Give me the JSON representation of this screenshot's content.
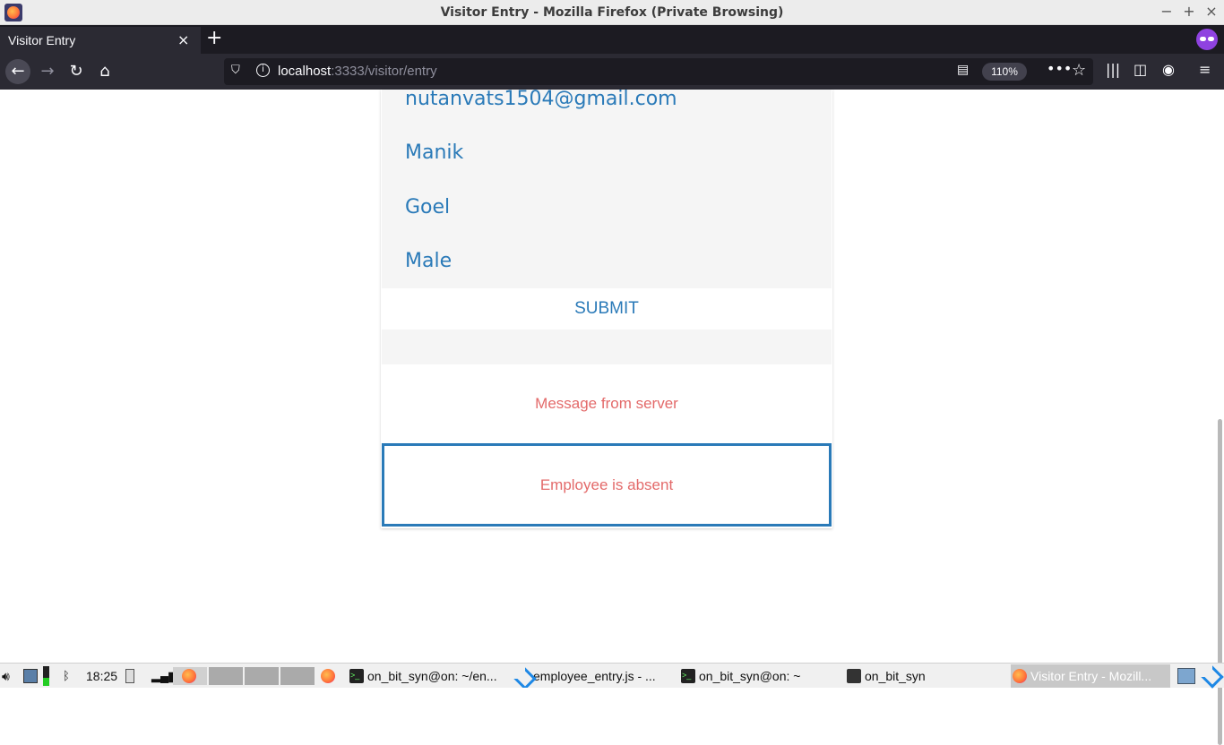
{
  "window": {
    "title": "Visitor Entry - Mozilla Firefox (Private Browsing)",
    "minimize": "−",
    "maximize": "+",
    "close": "×"
  },
  "tabs": [
    {
      "label": "Visitor Entry",
      "close": "×"
    }
  ],
  "new_tab": "+",
  "nav": {
    "back": "←",
    "forward": "→",
    "reload": "↻",
    "home": "⌂",
    "url_host": "localhost",
    "url_rest": ":3333/visitor/entry",
    "zoom": "110%",
    "more": "•••",
    "star": "☆",
    "library": "|||",
    "sidebar": "◫",
    "account": "◉",
    "menu": "≡"
  },
  "form": {
    "email": "nutanvats1504@gmail.com",
    "first_name": "Manik",
    "last_name": "Goel",
    "gender": "Male",
    "submit_label": "SUBMIT",
    "message_title": "Message from server",
    "message": "Employee is absent"
  },
  "taskbar": {
    "clock": "18:25",
    "tasks": [
      {
        "label": "on_bit_syn@on: ~/en...",
        "icon": "terminal-icon"
      },
      {
        "label": "employee_entry.js - ...",
        "icon": "vscode-icon"
      },
      {
        "label": "on_bit_syn@on: ~",
        "icon": "terminal-icon"
      },
      {
        "label": "on_bit_syn",
        "icon": "folder-icon"
      },
      {
        "label": "Visitor Entry - Mozill...",
        "icon": "firefox-icon"
      }
    ]
  }
}
